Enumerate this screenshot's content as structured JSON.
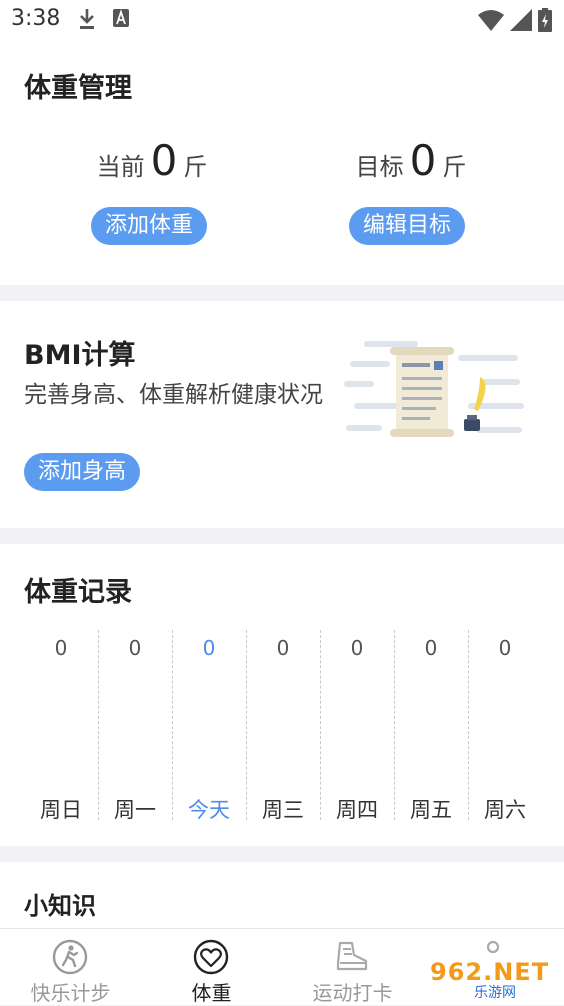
{
  "status_bar": {
    "time": "3:38"
  },
  "weight_management": {
    "title": "体重管理",
    "current": {
      "label": "当前",
      "value": "0",
      "unit": "斤"
    },
    "target": {
      "label": "目标",
      "value": "0",
      "unit": "斤"
    },
    "add_weight_button": "添加体重",
    "edit_target_button": "编辑目标"
  },
  "bmi": {
    "title": "BMI计算",
    "description": "完善身高、体重解析健康状况",
    "add_height_button": "添加身高"
  },
  "weight_record": {
    "title": "体重记录",
    "days": [
      {
        "label": "周日",
        "value": "0"
      },
      {
        "label": "周一",
        "value": "0"
      },
      {
        "label": "今天",
        "value": "0",
        "active": true
      },
      {
        "label": "周三",
        "value": "0"
      },
      {
        "label": "周四",
        "value": "0"
      },
      {
        "label": "周五",
        "value": "0"
      },
      {
        "label": "周六",
        "value": "0"
      }
    ]
  },
  "tips": {
    "title": "小知识"
  },
  "tab_bar": {
    "tabs": [
      {
        "label": "快乐计步",
        "icon": "walking-person-icon"
      },
      {
        "label": "体重",
        "icon": "heart-icon",
        "active": true
      },
      {
        "label": "运动打卡",
        "icon": "shoe-icon"
      },
      {
        "label": "",
        "icon": "profile-icon"
      }
    ]
  },
  "watermark": {
    "text": "962.NET",
    "sub": "乐游网"
  },
  "colors": {
    "accent": "#5b9bf0",
    "active_day": "#4f8be8",
    "background": "#f2f2f5"
  }
}
